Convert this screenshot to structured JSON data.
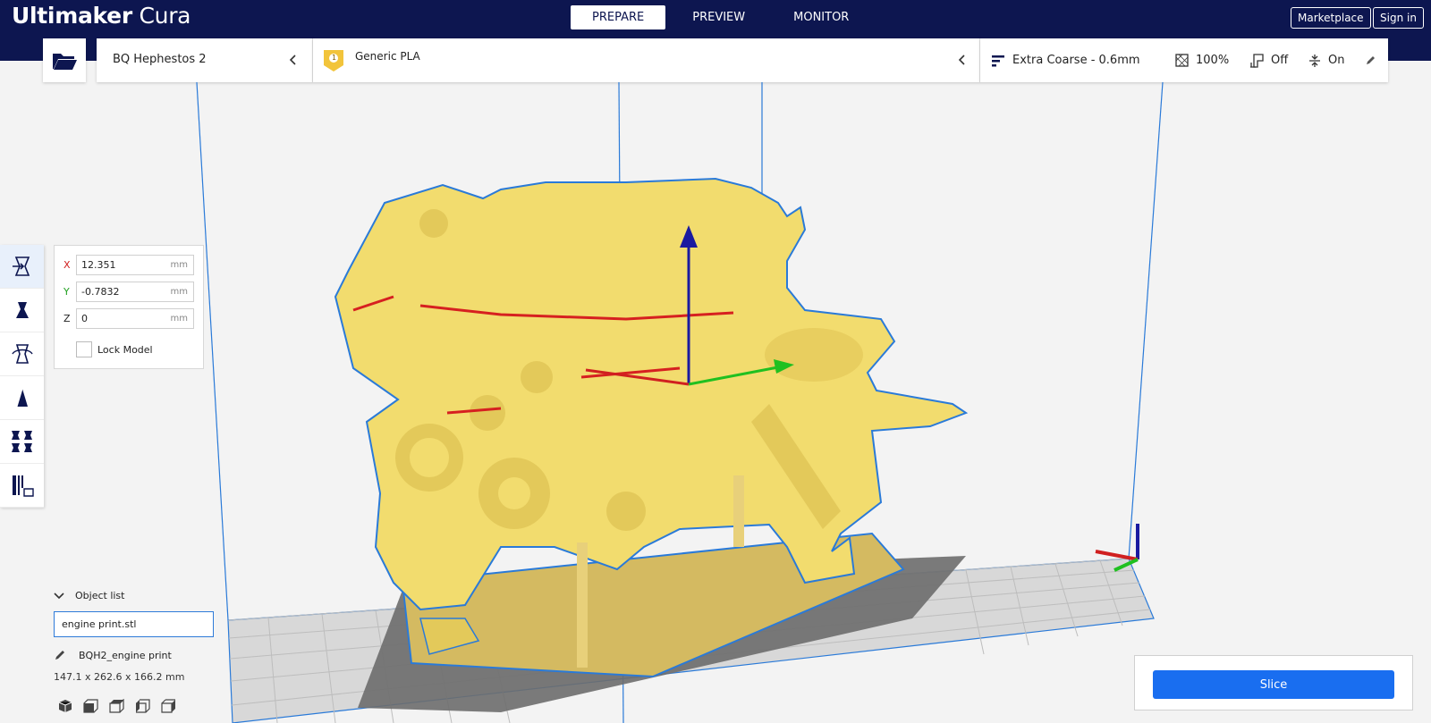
{
  "app": {
    "logo_bold": "Ultimaker",
    "logo_light": " Cura"
  },
  "stages": [
    {
      "label": "PREPARE",
      "active": true
    },
    {
      "label": "PREVIEW",
      "active": false
    },
    {
      "label": "MONITOR",
      "active": false
    }
  ],
  "topbar": {
    "marketplace": "Marketplace",
    "signin": "Sign in"
  },
  "header": {
    "printer": "BQ Hephestos 2",
    "extruder_number": "1",
    "material": "Generic PLA",
    "profile": "Extra Coarse - 0.6mm",
    "infill": "100%",
    "support": "Off",
    "adhesion": "On"
  },
  "move_panel": {
    "x_label": "X",
    "x_value": "12.351",
    "y_label": "Y",
    "y_value": "-0.7832",
    "z_label": "Z",
    "z_value": "0",
    "unit": "mm",
    "lock_label": "Lock Model"
  },
  "object_list": {
    "title": "Object list",
    "file": "engine print.stl",
    "object_name": "BQH2_engine print",
    "dimensions": "147.1 x 262.6 x 166.2 mm"
  },
  "slice": {
    "label": "Slice"
  },
  "colors": {
    "topbar": "#0d1650",
    "accent": "#196ef0",
    "model": "#f2dc6e",
    "axis_x": "#d02020",
    "axis_y": "#20c020",
    "axis_z": "#1a1aa0"
  },
  "icons": [
    "folder-open-icon",
    "chevron-left-icon",
    "extruder-badge-icon",
    "profile-icon",
    "infill-icon",
    "support-icon",
    "adhesion-icon",
    "pencil-icon",
    "move-tool-icon",
    "scale-tool-icon",
    "rotate-tool-icon",
    "mirror-tool-icon",
    "per-model-settings-icon",
    "support-blocker-icon",
    "chevron-down-icon",
    "pencil-edit-icon",
    "view-3d-icon",
    "view-front-icon",
    "view-top-icon",
    "view-left-icon",
    "view-right-icon"
  ]
}
